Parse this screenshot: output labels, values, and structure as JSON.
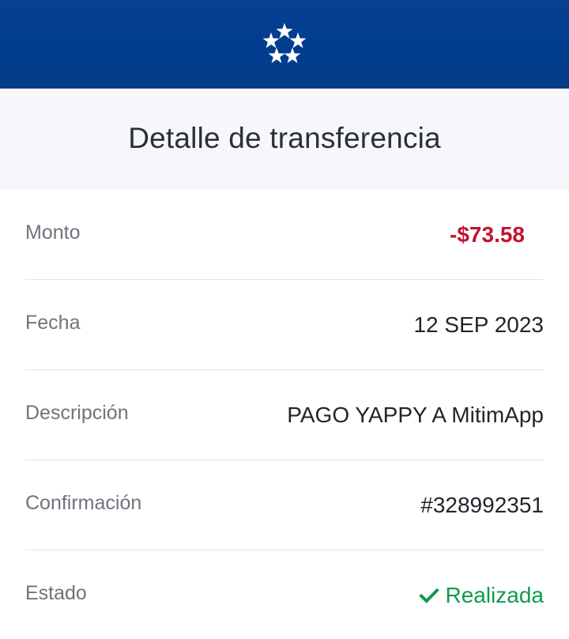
{
  "header": {
    "logo_icon": "five-stars-logo-icon",
    "brand_color": "#0a3f91"
  },
  "title": "Detalle de transferencia",
  "details": [
    {
      "label": "Monto",
      "value": "-$73.58",
      "value_color": "#c4122f"
    },
    {
      "label": "Fecha",
      "value": "12 SEP 2023"
    },
    {
      "label": "Descripción",
      "value": "PAGO YAPPY A MitimApp"
    },
    {
      "label": "Confirmación",
      "value": "#328992351"
    },
    {
      "label": "Estado",
      "value": "Realizada",
      "icon": "check-icon",
      "value_color": "#109a4f"
    }
  ]
}
